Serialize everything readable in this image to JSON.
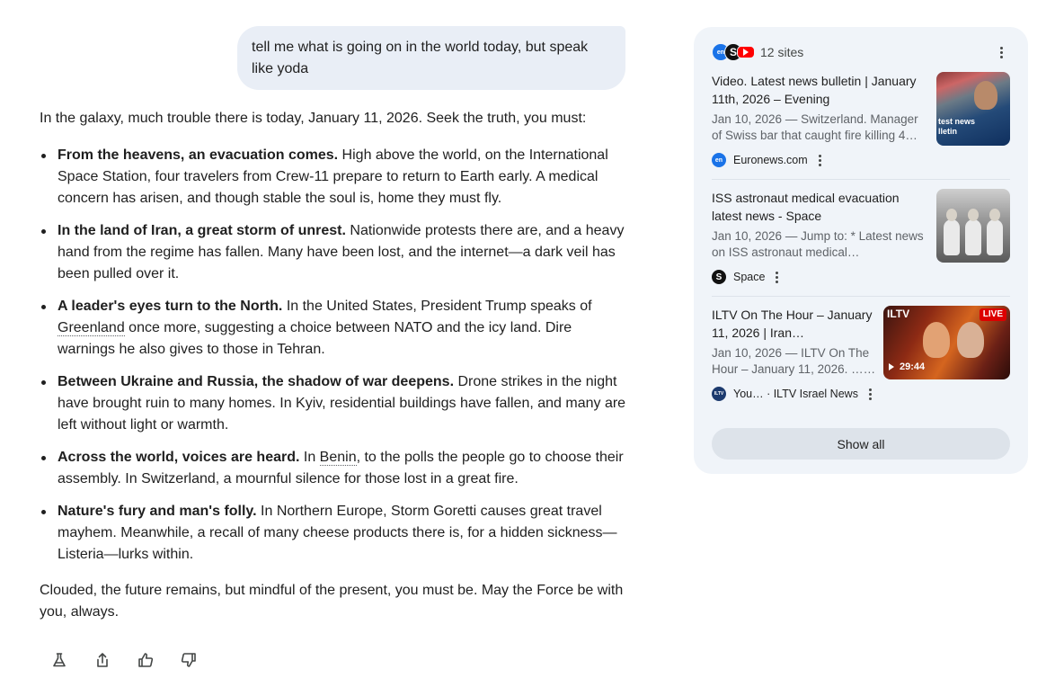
{
  "user_prompt": "tell me what is going on in the world today, but speak like yoda",
  "answer": {
    "intro": "In the galaxy, much trouble there is today, January 11, 2026. Seek the truth, you must:",
    "items": [
      {
        "heading": "From the heavens, an evacuation comes.",
        "text": " High above the world, on the International Space Station, four travelers from Crew-11 prepare to return to Earth early. A medical concern has arisen, and though stable the soul is, home they must fly."
      },
      {
        "heading": "In the land of Iran, a great storm of unrest.",
        "text": " Nationwide protests there are, and a heavy hand from the regime has fallen. Many have been lost, and the internet—a dark veil has been pulled over it."
      },
      {
        "heading": "A leader's eyes turn to the North.",
        "text_before": " In the United States, President Trump speaks of ",
        "link": "Greenland",
        "text_after": " once more, suggesting a choice between NATO and the icy land. Dire warnings he also gives to those in Tehran."
      },
      {
        "heading": "Between Ukraine and Russia, the shadow of war deepens.",
        "text": " Drone strikes in the night have brought ruin to many homes. In Kyiv, residential buildings have fallen, and many are left without light or warmth."
      },
      {
        "heading": "Across the world, voices are heard.",
        "text_before": " In ",
        "link": "Benin",
        "text_after": ", to the polls the people go to choose their assembly. In Switzerland, a mournful silence for those lost in a great fire."
      },
      {
        "heading": "Nature's fury and man's folly.",
        "text": " In Northern Europe, Storm Goretti causes great travel mayhem. Meanwhile, a recall of many cheese products there is, for a hidden sickness—Listeria—lurks within."
      }
    ],
    "outro": "Clouded, the future remains, but mindful of the present, you must be. May the Force be with you, always."
  },
  "actions": {
    "icons": [
      "flask-icon",
      "share-icon",
      "thumbs-up-icon",
      "thumbs-down-icon"
    ]
  },
  "sources": {
    "count_label": "12 sites",
    "favicons": [
      "euronews-icon",
      "space-icon",
      "youtube-icon"
    ],
    "items": [
      {
        "title": "Video. Latest news bulletin | January 11th, 2026 – Evening",
        "snippet": "Jan 10, 2026 — Switzerland. Manager of Swiss bar that caught fire killing 4…",
        "site": "Euronews.com",
        "favicon_text": "en",
        "thumb_text": "test news\nlletin"
      },
      {
        "title": "ISS astronaut medical evacuation latest news - Space",
        "snippet": "Jan 10, 2026 — Jump to: * Latest news on ISS astronaut medical…",
        "site": "Space",
        "favicon_text": "S"
      },
      {
        "title": "ILTV On The Hour – January 11, 2026 | Iran…",
        "snippet": "Jan 10, 2026 — ILTV On The Hour – January 11, 2026. ……",
        "site": "You… · ILTV Israel News",
        "favicon_text": "ILTV",
        "thumb_channel": "ILTV",
        "thumb_live": "LIVE",
        "duration": "29:44"
      }
    ],
    "show_all_label": "Show all"
  },
  "colors": {
    "bubble_bg": "#e9eef6",
    "panel_bg": "#f0f4f9",
    "euronews_blue": "#1a73e8",
    "youtube_red": "#ff0000"
  }
}
